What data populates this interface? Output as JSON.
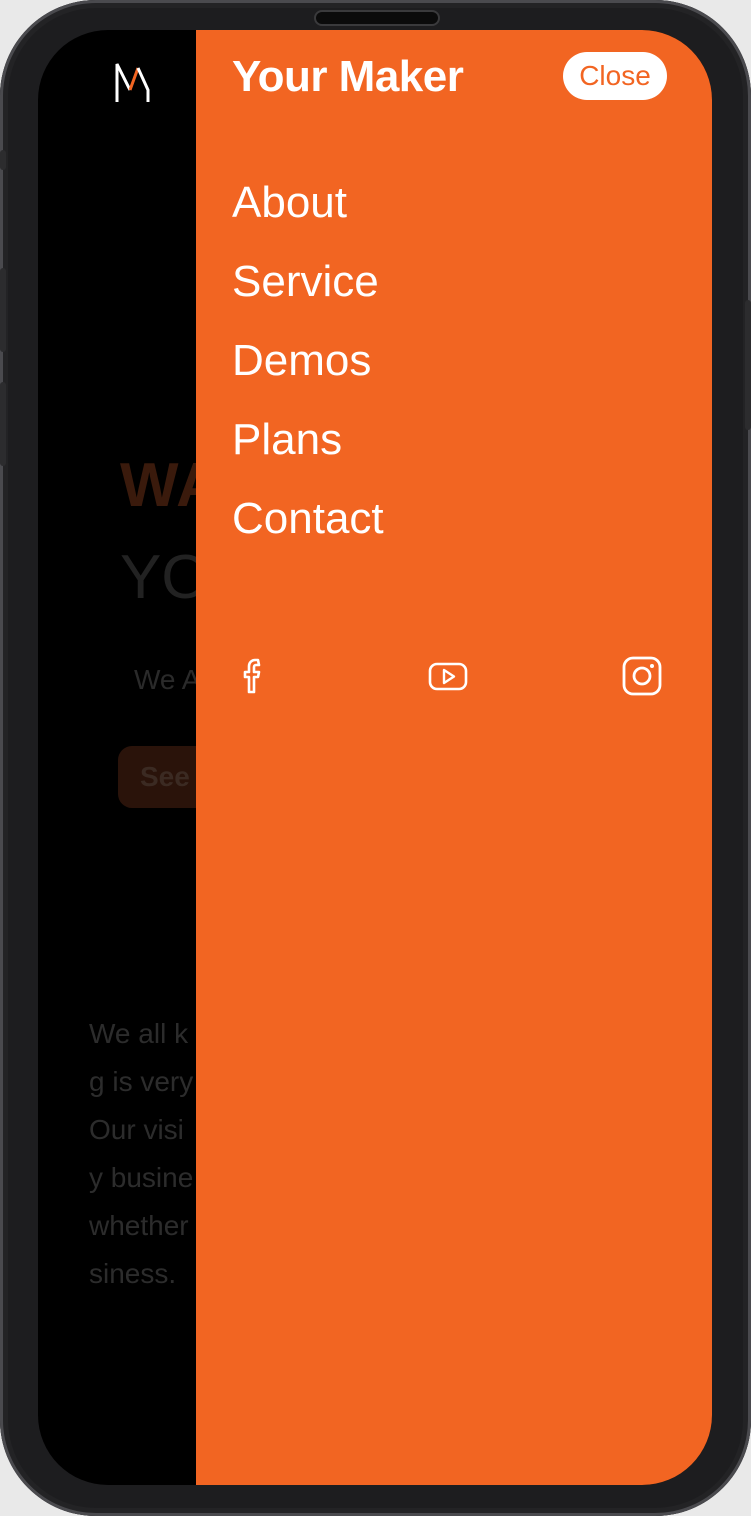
{
  "drawer": {
    "brand": "Your Maker",
    "close_label": "Close",
    "menu": [
      "About",
      "Service",
      "Demos",
      "Plans",
      "Contact"
    ],
    "social": [
      "facebook-icon",
      "youtube-icon",
      "instagram-icon"
    ],
    "color": "#f26522"
  },
  "background_page": {
    "hero_title": "WA",
    "hero_subtitle": "YO",
    "hero_description": "We A",
    "hero_button": "See",
    "about_lines": [
      "We all k",
      "g is very",
      "Our visi",
      "y busine",
      "whether",
      "siness."
    ]
  }
}
